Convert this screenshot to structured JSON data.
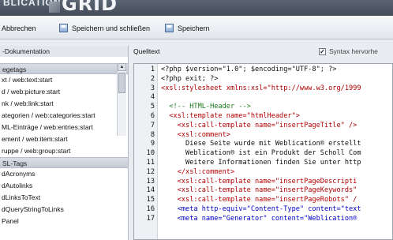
{
  "banner": {
    "brand_text": "BLICATION",
    "brand_logo": "GRID"
  },
  "toolbar": {
    "cancel_label": "Abbrechen",
    "save_close_label": "Speichern und schließen",
    "save_label": "Speichern"
  },
  "left_panel": {
    "title": "-Dokumentation",
    "section1_header": "egetags",
    "section1_items": [
      "xt / web:text:start",
      "d / web:picture:start",
      "nk / web:link:start",
      "ategorien / web:categories:start",
      "ML-Einträge / web:entries:start",
      "ement / web:item:start",
      "ruppe / web:group:start"
    ],
    "section2_header": "SL-Tags",
    "section2_items": [
      "dAcronyms",
      "dAutolinks",
      "dLinksToText",
      "dQueryStringToLinks",
      "Panel"
    ]
  },
  "right_panel": {
    "title": "Quelltext",
    "syntax_label": "Syntax hervorhe",
    "syntax_checked": true,
    "syntax_check_mark": "✓"
  },
  "editor": {
    "lines": [
      {
        "n": "1",
        "segments": [
          {
            "t": "<?php $version=\"1.0\"; $encoding=\"UTF-8\"; ?>",
            "c": "black"
          }
        ]
      },
      {
        "n": "2",
        "segments": [
          {
            "t": "<?php exit; ?>",
            "c": "black"
          }
        ]
      },
      {
        "n": "3",
        "segments": [
          {
            "t": "<xsl:stylesheet xmlns:xsl=\"http://www.w3.org/1999",
            "c": "red"
          }
        ]
      },
      {
        "n": "4",
        "segments": [
          {
            "t": "",
            "c": "black"
          }
        ]
      },
      {
        "n": "5",
        "segments": [
          {
            "t": "  <!-- HTML-Header -->",
            "c": "green"
          }
        ]
      },
      {
        "n": "6",
        "segments": [
          {
            "t": "  <xsl:template name=\"htmlHeader\">",
            "c": "red"
          }
        ]
      },
      {
        "n": "7",
        "segments": [
          {
            "t": "    <xsl:call-template name=\"insertPageTitle\" />",
            "c": "red"
          }
        ]
      },
      {
        "n": "8",
        "segments": [
          {
            "t": "    <xsl:comment>",
            "c": "red"
          }
        ]
      },
      {
        "n": "9",
        "segments": [
          {
            "t": "      Diese Seite wurde mit Weblication® erstellt",
            "c": "black"
          }
        ]
      },
      {
        "n": "10",
        "segments": [
          {
            "t": "      Weblication® ist ein Produkt der Scholl Com",
            "c": "black"
          }
        ]
      },
      {
        "n": "11",
        "segments": [
          {
            "t": "      Weitere Informationen finden Sie unter http",
            "c": "black"
          }
        ]
      },
      {
        "n": "12",
        "segments": [
          {
            "t": "    </xsl:comment>",
            "c": "red"
          }
        ]
      },
      {
        "n": "13",
        "segments": [
          {
            "t": "    <xsl:call-template name=\"insertPageDescripti",
            "c": "red"
          }
        ]
      },
      {
        "n": "14",
        "segments": [
          {
            "t": "    <xsl:call-template name=\"insertPageKeywords\"",
            "c": "red"
          }
        ]
      },
      {
        "n": "15",
        "segments": [
          {
            "t": "    <xsl:call-template name=\"insertPageRobots\" /",
            "c": "red"
          }
        ]
      },
      {
        "n": "16",
        "segments": [
          {
            "t": "    <meta http-equiv=\"Content-Type\" content=\"text",
            "c": "blue"
          }
        ]
      },
      {
        "n": "17",
        "segments": [
          {
            "t": "    <meta name=\"Generator\" content=\"Weblication®",
            "c": "blue"
          }
        ]
      }
    ]
  },
  "colors": {
    "banner": "#4e5764",
    "code_black": "#111111",
    "code_red": "#b00000",
    "code_green": "#1e7a1e",
    "code_blue": "#0000c8"
  },
  "icons": {
    "toolbar_cancel": "none",
    "toolbar_save_close": "save-disk-icon",
    "toolbar_save": "save-disk-icon",
    "scroll_up": "arrow-up-icon"
  }
}
